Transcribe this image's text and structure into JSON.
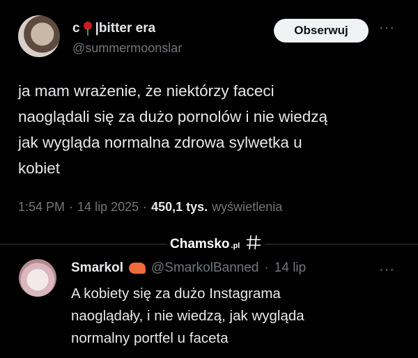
{
  "tweet": {
    "author_name": "c",
    "author_name_suffix": "|bitter era",
    "author_handle": "@summermoonslar",
    "follow_label": "Obserwuj",
    "more_label": "···",
    "text": "ja mam wrażenie, że niektórzy faceci\nnaoglądali się za dużo pornolów i nie wiedzą\njak wygląda normalna zdrowa  sylwetka u\nkobiet",
    "time": "1:54 PM",
    "date": "14 lip 2025",
    "views_count": "450,1 tys.",
    "views_label": "wyświetlenia",
    "separator": "·"
  },
  "watermark": {
    "text": "Chamsko",
    "suffix": ".pl"
  },
  "reply": {
    "author_name": "Smarkol",
    "author_handle": "@SmarkolBanned",
    "date": "14 lip",
    "separator": "·",
    "more_label": "···",
    "text": "A kobiety się za dużo Instagrama\nnaoglądały, i nie wiedzą, jak wygląda\nnormalny portfel u faceta"
  },
  "icons": [
    "rose-icon",
    "hash-icon",
    "shrimp-icon",
    "more-icon"
  ]
}
